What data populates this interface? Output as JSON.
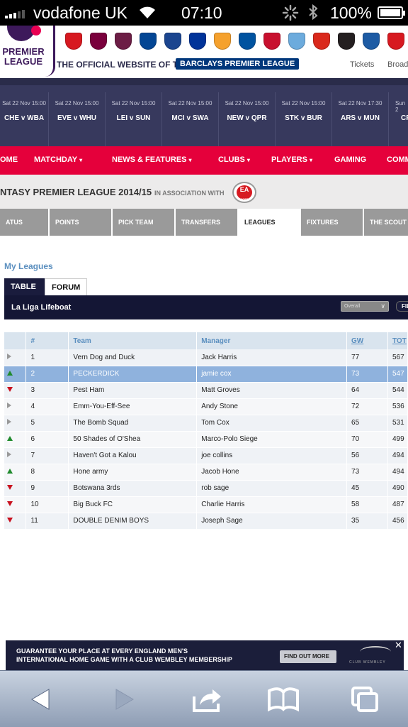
{
  "status_bar": {
    "carrier": "vodafone UK",
    "time": "07:10",
    "battery": "100%",
    "signal_icon": "signal-bars",
    "wifi_icon": "wifi",
    "activity_icon": "spinner",
    "bluetooth_icon": "bluetooth"
  },
  "header": {
    "logo_line1": "PREMIER",
    "logo_line2": "LEAGUE",
    "official_text": "THE OFFICIAL WEBSITE OF THE",
    "sponsor_text": "BARCLAYS PREMIER LEAGUE",
    "links": [
      "Tickets",
      "Broad"
    ],
    "crest_colors": [
      "#d71920",
      "#7a003c",
      "#6c1d45",
      "#034694",
      "#1b458f",
      "#003399",
      "#f5a12d",
      "#0053a0",
      "#c8102e",
      "#6cabdd",
      "#da291c",
      "#241f20",
      "#1d5ba4",
      "#d71920"
    ]
  },
  "fixtures": [
    {
      "date": "Sat 22 Nov 15:00",
      "match": "CHE v WBA"
    },
    {
      "date": "Sat 22 Nov 15:00",
      "match": "EVE v WHU"
    },
    {
      "date": "Sat 22 Nov 15:00",
      "match": "LEI v SUN"
    },
    {
      "date": "Sat 22 Nov 15:00",
      "match": "MCI v SWA"
    },
    {
      "date": "Sat 22 Nov 15:00",
      "match": "NEW v QPR"
    },
    {
      "date": "Sat 22 Nov 15:00",
      "match": "STK v BUR"
    },
    {
      "date": "Sat 22 Nov 17:30",
      "match": "ARS v MUN"
    },
    {
      "date": "Sun 2",
      "match": "CR"
    }
  ],
  "main_nav": [
    {
      "label": "OME",
      "dropdown": false
    },
    {
      "label": "MATCHDAY",
      "dropdown": true
    },
    {
      "label": "NEWS & FEATURES",
      "dropdown": true
    },
    {
      "label": "CLUBS",
      "dropdown": true
    },
    {
      "label": "PLAYERS",
      "dropdown": true
    },
    {
      "label": "GAMING",
      "dropdown": false
    },
    {
      "label": "COMM",
      "dropdown": false
    }
  ],
  "fpl": {
    "title": "NTASY PREMIER LEAGUE 2014/15",
    "association": "IN ASSOCIATION WITH",
    "ea_line1": "EA",
    "ea_line2": "SPORTS"
  },
  "fpl_tabs": [
    {
      "label": "ATUS",
      "active": false
    },
    {
      "label": "POINTS",
      "active": false
    },
    {
      "label": "PICK TEAM",
      "active": false
    },
    {
      "label": "TRANSFERS",
      "active": false
    },
    {
      "label": "LEAGUES",
      "active": true
    },
    {
      "label": "FIXTURES",
      "active": false
    },
    {
      "label": "THE SCOUT",
      "active": false
    }
  ],
  "my_leagues": {
    "heading": "My Leagues",
    "tabs": [
      "TABLE",
      "FORUM"
    ],
    "active_tab": "TABLE",
    "league_name": "La Liga Lifeboat",
    "filter_value": "Overall",
    "filter_button": "FIL"
  },
  "standings": {
    "columns": [
      "",
      "#",
      "Team",
      "Manager",
      "GW",
      "TOT"
    ],
    "highlighted_rank": 2,
    "rows": [
      {
        "movement": "same",
        "rank": "1",
        "team": "Vern Dog and Duck",
        "manager": "Jack Harris",
        "gw": "77",
        "tot": "567"
      },
      {
        "movement": "up",
        "rank": "2",
        "team": "PECKERDICK",
        "manager": "jamie cox",
        "gw": "73",
        "tot": "547"
      },
      {
        "movement": "down",
        "rank": "3",
        "team": "Pest Ham",
        "manager": "Matt Groves",
        "gw": "64",
        "tot": "544"
      },
      {
        "movement": "same",
        "rank": "4",
        "team": "Emm-You-Eff-See",
        "manager": "Andy Stone",
        "gw": "72",
        "tot": "536"
      },
      {
        "movement": "same",
        "rank": "5",
        "team": "The Bomb Squad",
        "manager": "Tom Cox",
        "gw": "65",
        "tot": "531"
      },
      {
        "movement": "up",
        "rank": "6",
        "team": "50 Shades of O'Shea",
        "manager": "Marco-Polo Siege",
        "gw": "70",
        "tot": "499"
      },
      {
        "movement": "same",
        "rank": "7",
        "team": "Haven't Got a Kalou",
        "manager": "joe collins",
        "gw": "56",
        "tot": "494"
      },
      {
        "movement": "up",
        "rank": "8",
        "team": "Hone army",
        "manager": "Jacob Hone",
        "gw": "73",
        "tot": "494"
      },
      {
        "movement": "down",
        "rank": "9",
        "team": "Botswana 3rds",
        "manager": "rob sage",
        "gw": "45",
        "tot": "490"
      },
      {
        "movement": "down",
        "rank": "10",
        "team": "Big Buck FC",
        "manager": "Charlie Harris",
        "gw": "58",
        "tot": "487"
      },
      {
        "movement": "down",
        "rank": "11",
        "team": "DOUBLE DENIM BOYS",
        "manager": "Joseph Sage",
        "gw": "35",
        "tot": "456"
      }
    ]
  },
  "ad": {
    "line1": "GUARANTEE YOUR PLACE AT EVERY ENGLAND MEN'S",
    "line2": "INTERNATIONAL HOME GAME WITH A CLUB WEMBLEY MEMBERSHIP",
    "cta": "FIND OUT MORE",
    "brand": "CLUB WEMBLEY",
    "close": "✕"
  },
  "toolbar": {
    "icons": [
      "back-icon",
      "forward-icon",
      "share-icon",
      "bookmarks-icon",
      "tabs-icon"
    ]
  }
}
